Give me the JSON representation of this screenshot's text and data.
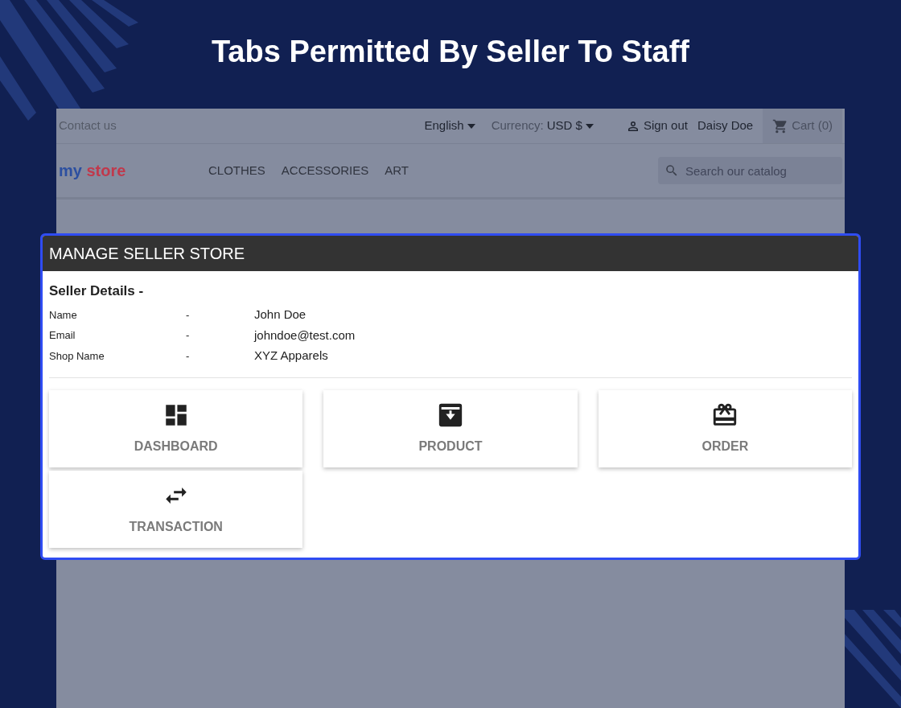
{
  "title": "Tabs Permitted By Seller To Staff",
  "store": {
    "topbar": {
      "contact": "Contact us",
      "language": "English",
      "currency_label": "Currency:",
      "currency": "USD $",
      "sign_out": "Sign out",
      "user": "Daisy Doe",
      "cart": "Cart (0)"
    },
    "logo": [
      "my",
      "store"
    ],
    "menu": [
      "CLOTHES",
      "ACCESSORIES",
      "ART"
    ],
    "search": {
      "placeholder": "Search our catalog"
    }
  },
  "modal": {
    "title": "MANAGE SELLER STORE",
    "details_heading": "Seller Details -",
    "details": [
      {
        "label": "Name",
        "separator": "-",
        "value": "John Doe"
      },
      {
        "label": "Email",
        "separator": "-",
        "value": "johndoe@test.com"
      },
      {
        "label": "Shop Name",
        "separator": "-",
        "value": "XYZ Apparels"
      }
    ],
    "tiles": [
      {
        "kind": "dashboard",
        "label": "DASHBOARD"
      },
      {
        "kind": "product",
        "label": "PRODUCT"
      },
      {
        "kind": "order",
        "label": "ORDER"
      },
      {
        "kind": "transaction",
        "label": "TRANSACTION"
      }
    ]
  }
}
